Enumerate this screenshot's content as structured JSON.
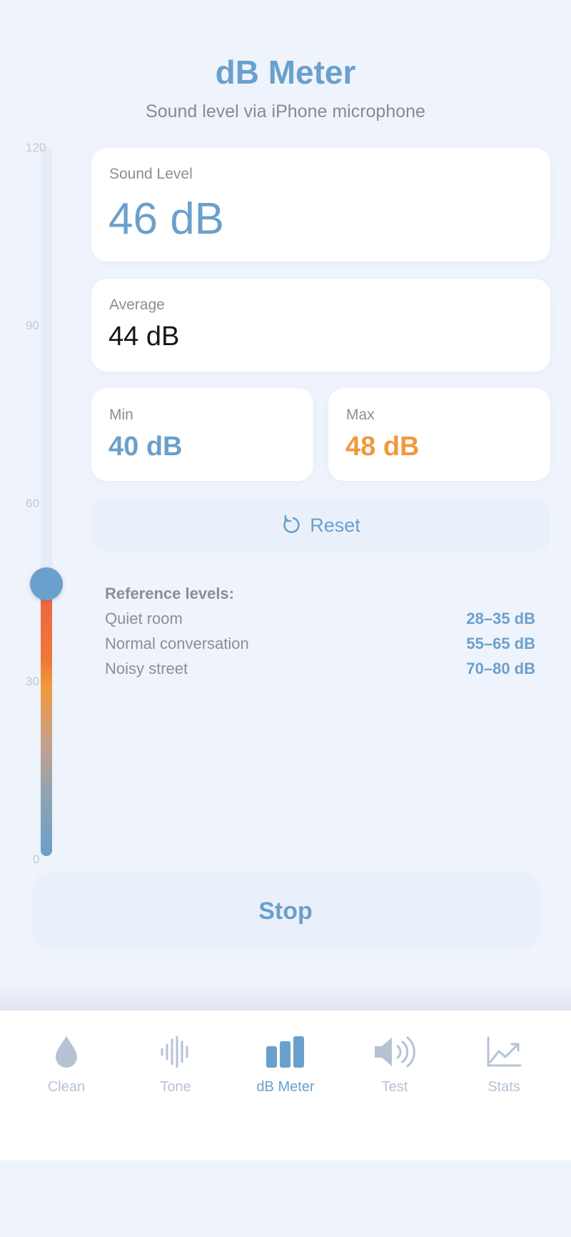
{
  "header": {
    "title": "dB Meter",
    "subtitle": "Sound level via iPhone microphone"
  },
  "meter": {
    "ticks": [
      "120",
      "90",
      "60",
      "30",
      "0"
    ],
    "max_db": 120,
    "current_db": 46
  },
  "cards": {
    "sound_level": {
      "label": "Sound Level",
      "value": "46 dB"
    },
    "average": {
      "label": "Average",
      "value": "44 dB"
    },
    "min": {
      "label": "Min",
      "value": "40 dB"
    },
    "max": {
      "label": "Max",
      "value": "48 dB"
    }
  },
  "reset": {
    "label": "Reset"
  },
  "reference": {
    "title": "Reference levels:",
    "rows": [
      {
        "name": "Quiet room",
        "range": "28–35 dB"
      },
      {
        "name": "Normal conversation",
        "range": "55–65 dB"
      },
      {
        "name": "Noisy street",
        "range": "70–80 dB"
      }
    ]
  },
  "stop": {
    "label": "Stop"
  },
  "tabs": [
    {
      "label": "Clean",
      "icon": "drop-icon",
      "active": false
    },
    {
      "label": "Tone",
      "icon": "waveform-icon",
      "active": false
    },
    {
      "label": "dB Meter",
      "icon": "bar-chart-icon",
      "active": true
    },
    {
      "label": "Test",
      "icon": "speaker-icon",
      "active": false
    },
    {
      "label": "Stats",
      "icon": "line-chart-icon",
      "active": false
    }
  ],
  "colors": {
    "accent": "#6aa0cc",
    "max_value": "#f09a3d",
    "background": "#eff3fc",
    "tab_inactive": "#b6c2d4"
  }
}
